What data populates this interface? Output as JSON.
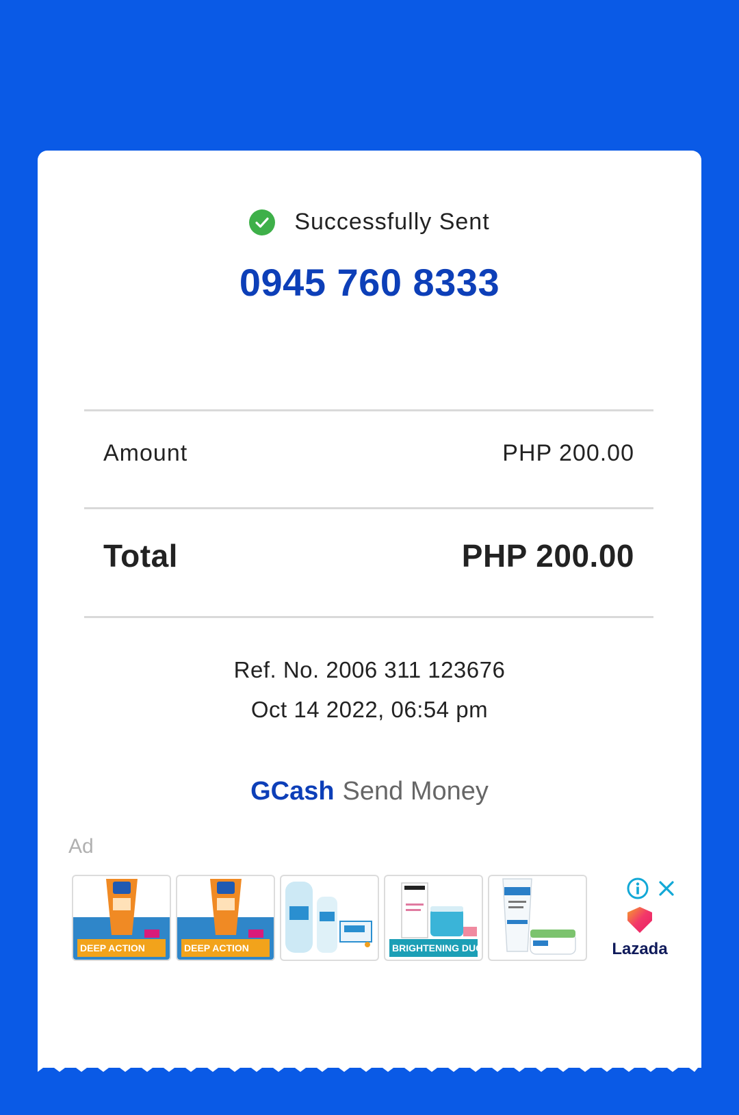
{
  "status": {
    "text": "Successfully Sent",
    "icon": "check-circle-icon",
    "icon_color": "#3eb049"
  },
  "recipient": {
    "number": "0945 760 8333",
    "color": "#0d3fb8"
  },
  "amount": {
    "label": "Amount",
    "value": "PHP 200.00"
  },
  "total": {
    "label": "Total",
    "value": "PHP 200.00"
  },
  "reference": {
    "line": "Ref. No. 2006 311 123676"
  },
  "date": {
    "line": "Oct 14 2022, 06:54 pm"
  },
  "footer": {
    "brand": "GCash",
    "service": "Send Money"
  },
  "ad": {
    "label": "Ad",
    "tiles": [
      {
        "banner": "DEEP ACTION",
        "banner_color": "#f2a31b"
      },
      {
        "banner": "DEEP ACTION",
        "banner_color": "#f2a31b"
      },
      {
        "banner": "",
        "banner_color": ""
      },
      {
        "banner": "BRIGHTENING DUO",
        "banner_color": "#1c9fb6"
      },
      {
        "banner": "",
        "banner_color": ""
      }
    ],
    "advertiser": "Lazada"
  },
  "colors": {
    "background": "#0a5ae6",
    "card": "#ffffff",
    "accent": "#0d3fb8"
  }
}
